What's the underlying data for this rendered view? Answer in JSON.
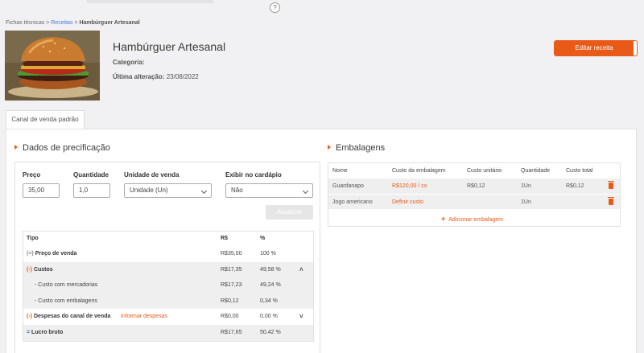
{
  "topbar": {
    "help_icon": "?"
  },
  "breadcrumb": {
    "root": "Fichas técnicas",
    "sep1": ">",
    "link": "Receitas",
    "sep2": ">",
    "current": "Hambúrguer Artesanal"
  },
  "recipe": {
    "title": "Hambúrguer Artesanal",
    "category_label": "Categoria:",
    "category_value": "",
    "last_change_label": "Última alteração:",
    "last_change_value": "23/08/2022",
    "image_icon": "burger-photo"
  },
  "actions": {
    "edit_label": "Editar receita"
  },
  "tabs": [
    {
      "label": "Canal de venda padrão",
      "active": true
    }
  ],
  "pricing": {
    "section_title": "Dados de precificação",
    "price_label": "Preço",
    "price_value": "35,00",
    "qty_label": "Quantidade",
    "qty_value": "1,0",
    "unit_label": "Unidade de venda",
    "unit_value": "Unidade (Un)",
    "show_label": "Exibir no cardápio",
    "show_value": "Não",
    "update_label": "Atualizar",
    "table": {
      "headers": [
        "Tipo",
        "R$",
        "%"
      ],
      "rows": [
        {
          "prefix": "(=)",
          "label": "Preço de venda",
          "value": "R$35,00",
          "pct": "100 %"
        },
        {
          "prefix": "(-)",
          "label": "Custos",
          "value": "R$17,35",
          "pct": "49,58 %",
          "chevron": "˄"
        },
        {
          "prefix": "-",
          "label": "Custo com mercadorias",
          "value": "R$17,23",
          "pct": "49,24 %"
        },
        {
          "prefix": "-",
          "label": "Custo com embalagens",
          "value": "R$0,12",
          "pct": "0,34 %"
        },
        {
          "prefix": "(-)",
          "label": "Despesas do canal de venda",
          "link": "Informar despesas",
          "value": "R$0,00",
          "pct": "0,00 %",
          "chevron": "˅"
        },
        {
          "prefix": "=",
          "label": "Lucro bruto",
          "value": "R$17,65",
          "pct": "50,42 %"
        }
      ]
    }
  },
  "packaging": {
    "section_title": "Embalagens",
    "headers": [
      "Nome",
      "Custo da embalagem",
      "Custo unitário",
      "Quantidade",
      "Custo total"
    ],
    "rows": [
      {
        "name": "Guardanapo",
        "cost": "R$120,00 / cx",
        "unit_cost": "R$0,12",
        "qty": "1Un",
        "total": "R$0,12"
      },
      {
        "name": "Jogo americano",
        "cost": "Definir custo",
        "unit_cost": "",
        "qty": "1Un",
        "total": ""
      }
    ],
    "add_label": "Adicionar embalagem",
    "add_icon": "+"
  },
  "colors": {
    "accent": "#e95a19",
    "link": "#4b7bd6"
  }
}
